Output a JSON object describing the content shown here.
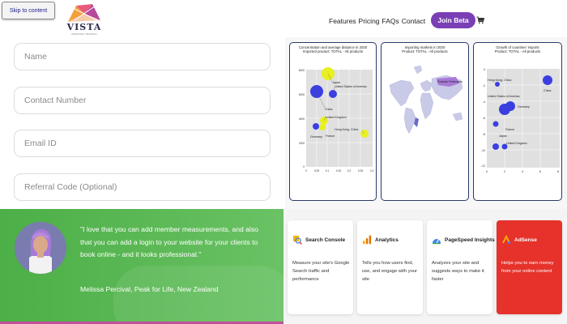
{
  "header": {
    "skip_link": "Skip to content",
    "logo": {
      "brand": "VISTA",
      "tagline": "PERSONAL TRAINING"
    },
    "nav": [
      "Features",
      "Pricing",
      "FAQs",
      "Contact"
    ],
    "join_button": "Join Beta",
    "cart_icon": "cart-icon"
  },
  "form": {
    "name_placeholder": "Name",
    "contact_placeholder": "Contact Number",
    "email_placeholder": "Email ID",
    "referral_placeholder": "Referral Code (Optional)"
  },
  "charts": {
    "chart1": {
      "title": "Concentration and average distance in 2020",
      "subtitle": "Imported product: TOTAL - All products",
      "y_ticks": [
        "8000",
        "6000",
        "4000",
        "2000",
        "0"
      ],
      "x_ticks": [
        "0",
        "0.05",
        "0.1",
        "0.15",
        "0.2",
        "0.25",
        "0.3"
      ],
      "labels": [
        "Japan",
        "United States of America",
        "China",
        "United Kingdom",
        "Hong Kong, China",
        "Germany",
        "France"
      ]
    },
    "chart2": {
      "title": "Importing markets in 2020",
      "subtitle": "Product: TOTAL - All products",
      "labels": [
        "Russian Federation"
      ]
    },
    "chart3": {
      "title": "Growth of countries' imports",
      "subtitle": "Product: TOTAL - All products",
      "y_ticks": [
        "0",
        "-2",
        "-4",
        "-6",
        "-8",
        "-10",
        "-12"
      ],
      "x_ticks": [
        "0",
        "2",
        "4",
        "6",
        "8"
      ],
      "labels": [
        "Hong Kong, China",
        "United States of America",
        "Germany",
        "China",
        "France",
        "Japan",
        "United Kingdom"
      ]
    },
    "colors": {
      "bubble_blue": "#3b3fe0",
      "bubble_yellow": "#e8f021",
      "map_land": "#c9c9e8",
      "map_water": "#dfe3ee"
    }
  },
  "testimonial": {
    "quote": "\"I love that you can add member measurements, and also that you can add a login to your website for your clients to book online - and it looks professional.\"",
    "author": "Melissa Percival, Peak for Life, New Zealand",
    "colors": {
      "green": "#54b44f"
    }
  },
  "tools": [
    {
      "title": "Search Console",
      "icon": "search-console-icon",
      "desc": "Measure your site's Google Search traffic and performance"
    },
    {
      "title": "Analytics",
      "icon": "analytics-icon",
      "desc": "Tells you how users find, use, and engage with your site"
    },
    {
      "title": "PageSpeed Insights",
      "icon": "pagespeed-icon",
      "desc": "Analyzes your site and suggests ways to make it faster"
    },
    {
      "title": "AdSense",
      "icon": "adsense-icon",
      "desc": "Helps you to earn money from your online content"
    }
  ]
}
